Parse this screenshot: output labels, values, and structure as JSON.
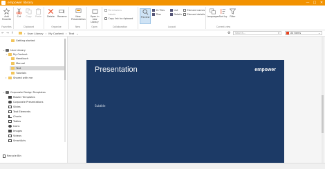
{
  "window": {
    "title": "empower library",
    "controls": [
      "—",
      "□",
      "✕"
    ]
  },
  "ribbon": {
    "groups": [
      {
        "label": "Favorites",
        "buttons": [
          {
            "label": "Add Favorite",
            "icon": "star-icon"
          }
        ]
      },
      {
        "label": "Clipboard",
        "buttons": [
          {
            "label": "Cut",
            "icon": "scissors-icon"
          },
          {
            "label": "Copy",
            "icon": "copy-icon"
          },
          {
            "label": "Paste",
            "icon": "paste-icon"
          }
        ]
      },
      {
        "label": "Organize",
        "buttons": [
          {
            "label": "Delete",
            "icon": "delete-icon"
          },
          {
            "label": "Rename",
            "icon": "rename-icon"
          }
        ]
      },
      {
        "label": "New",
        "buttons": [
          {
            "label": "New Presentation",
            "icon": "new-presentation-icon"
          }
        ]
      },
      {
        "label": "Open",
        "buttons": [
          {
            "label": "Open in new Library",
            "icon": "open-library-icon"
          }
        ]
      },
      {
        "label": "Collaboration",
        "items": [
          "Permissions",
          "Labels",
          "Copy link to clipboard"
        ]
      },
      {
        "label": "Layout",
        "preview": "Preview",
        "items": [
          "XL Tiles",
          "List",
          "Element names",
          "Tiles",
          "Details",
          "Element details"
        ]
      },
      {
        "label": "Current view",
        "buttons": [
          {
            "label": "Languages",
            "icon": "languages-icon"
          },
          {
            "label": "Sort by",
            "icon": "sort-icon"
          },
          {
            "label": "Filter",
            "icon": "filter-icon"
          }
        ]
      }
    ]
  },
  "addressbar": {
    "breadcrumbs": [
      "User Library",
      "My Content",
      "Text"
    ],
    "search_placeholder": "Search...",
    "filter_value": "All Items"
  },
  "sidebar": {
    "items": [
      {
        "label": "Getting started",
        "level": 1
      },
      {
        "label": "User Library",
        "level": 0
      },
      {
        "label": "My Content",
        "level": 1
      },
      {
        "label": "Handbuch",
        "level": 2
      },
      {
        "label": "Manual",
        "level": 2
      },
      {
        "label": "Text",
        "level": 2,
        "selected": true
      },
      {
        "label": "Tutorials",
        "level": 2
      },
      {
        "label": "Shared with me",
        "level": 1
      },
      {
        "label": "Corporate Design Templates",
        "level": 0
      },
      {
        "label": "Master Templates",
        "level": 1
      },
      {
        "label": "Corporate Presentations",
        "level": 1
      },
      {
        "label": "Slides",
        "level": 1
      },
      {
        "label": "Text Elements",
        "level": 1
      },
      {
        "label": "Charts",
        "level": 1
      },
      {
        "label": "Tables",
        "level": 1
      },
      {
        "label": "Icons",
        "level": 1
      },
      {
        "label": "Images",
        "level": 1
      },
      {
        "label": "Videos",
        "level": 1
      },
      {
        "label": "SmartArts",
        "level": 1
      }
    ],
    "recycle_bin": "Recycle Bin"
  },
  "preview": {
    "title": "Presentation",
    "subtitle": "Subtitle",
    "brand": "empower"
  },
  "colors": {
    "accent": "#f29200",
    "slide_bg": "#1c3a66"
  }
}
